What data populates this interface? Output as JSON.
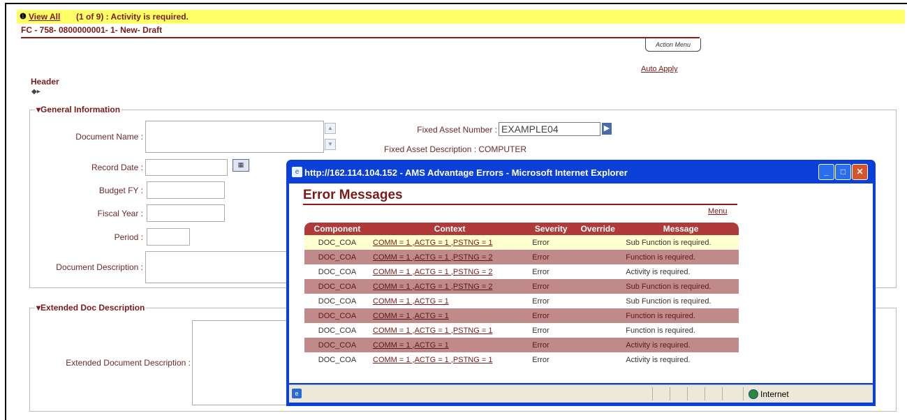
{
  "banner": {
    "icon": "info-icon",
    "view_all": "View All",
    "message": "(1 of 9) : Activity is required."
  },
  "document": {
    "id": "FC - 758- 0800000001- 1- New- Draft",
    "action_menu": "Action Menu",
    "auto_apply": "Auto Apply",
    "header_label": "Header"
  },
  "general": {
    "title": "▾General Information",
    "document_name_label": "Document Name :",
    "record_date_label": "Record Date :",
    "budget_fy_label": "Budget FY :",
    "fiscal_year_label": "Fiscal Year :",
    "period_label": "Period :",
    "document_description_label": "Document Description :",
    "fixed_asset_number_label": "Fixed Asset Number :",
    "fixed_asset_number_value": "EXAMPLE04",
    "fixed_asset_description": "Fixed Asset Description : COMPUTER"
  },
  "extended": {
    "title": "▾Extended Doc Description",
    "label": "Extended Document Description :"
  },
  "popup": {
    "title": "http://162.114.104.152 - AMS Advantage Errors - Microsoft Internet Explorer",
    "heading": "Error Messages",
    "menu": "Menu",
    "columns": [
      "Component",
      "Context",
      "Severity",
      "Override",
      "Message"
    ],
    "rows": [
      {
        "component": "DOC_COA",
        "context": "COMM = 1 ,ACTG = 1 ,PSTNG = 1",
        "severity": "Error",
        "override": "",
        "message": "Sub Function is required."
      },
      {
        "component": "DOC_COA",
        "context": "COMM = 1 ,ACTG = 1 ,PSTNG = 2",
        "severity": "Error",
        "override": "",
        "message": "Function is required."
      },
      {
        "component": "DOC_COA",
        "context": "COMM = 1 ,ACTG = 1 ,PSTNG = 2",
        "severity": "Error",
        "override": "",
        "message": "Activity is required."
      },
      {
        "component": "DOC_COA",
        "context": "COMM = 1 ,ACTG = 1 ,PSTNG = 2",
        "severity": "Error",
        "override": "",
        "message": "Sub Function is required."
      },
      {
        "component": "DOC_COA",
        "context": "COMM = 1 ,ACTG = 1",
        "severity": "Error",
        "override": "",
        "message": "Sub Function is required."
      },
      {
        "component": "DOC_COA",
        "context": "COMM = 1 ,ACTG = 1",
        "severity": "Error",
        "override": "",
        "message": "Function is required."
      },
      {
        "component": "DOC_COA",
        "context": "COMM = 1 ,ACTG = 1 ,PSTNG = 1",
        "severity": "Error",
        "override": "",
        "message": "Function is required."
      },
      {
        "component": "DOC_COA",
        "context": "COMM = 1 ,ACTG = 1",
        "severity": "Error",
        "override": "",
        "message": "Activity is required."
      },
      {
        "component": "DOC_COA",
        "context": "COMM = 1 ,ACTG = 1 ,PSTNG = 1",
        "severity": "Error",
        "override": "",
        "message": "Activity is required."
      }
    ],
    "status_zone": "Internet"
  },
  "colors": {
    "banner": "#ffff66",
    "brand": "#7a1a1a",
    "titlebar": "#0a3fd8",
    "table_header": "#b03a3a",
    "row_highlight": "#ffffd0",
    "row_dark": "#c08a8a"
  }
}
